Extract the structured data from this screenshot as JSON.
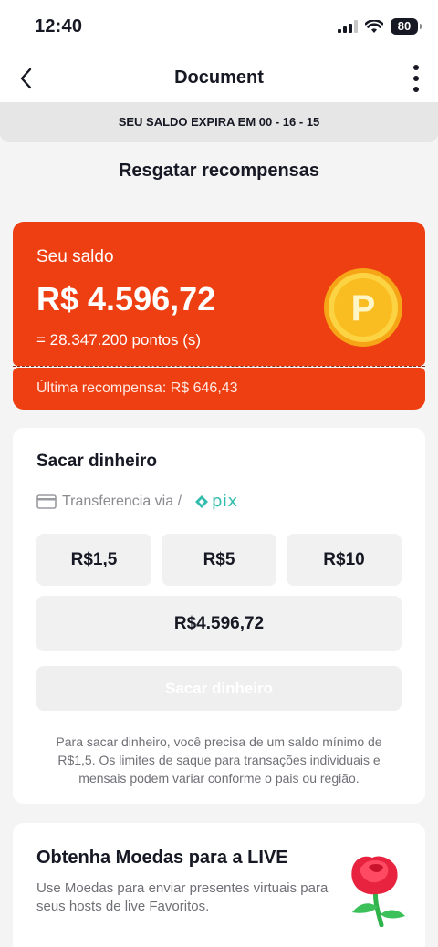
{
  "status_bar": {
    "time": "12:40",
    "battery": "80"
  },
  "nav": {
    "title": "Document"
  },
  "expiry": {
    "prefix": "SEU SALDO EXPIRA EM",
    "countdown": "00 - 16 - 15"
  },
  "page": {
    "title": "Resgatar recompensas"
  },
  "balance": {
    "label": "Seu saldo",
    "amount": "R$ 4.596,72",
    "points": "= 28.347.200 pontos (s)",
    "last_reward": "Última recompensa: R$ 646,43",
    "coin_letter": "P"
  },
  "withdraw": {
    "title": "Sacar dinheiro",
    "method": "Transferencia via /",
    "pix_label": "pix",
    "amounts": [
      "R$1,5",
      "R$5",
      "R$10"
    ],
    "full_amount": "R$4.596,72",
    "submit_label": "Sacar dinheiro",
    "note": "Para sacar dinheiro, você precisa de um saldo mínimo de R$1,5. Os limites de saque para transações individuais e mensais podem variar conforme o pais ou região."
  },
  "coins": {
    "title": "Obtenha Moedas para a LIVE",
    "description": "Use Moedas para enviar presentes virtuais para seus hosts de live Favoritos."
  },
  "colors": {
    "accent": "#ee3f12",
    "pix": "#32bcad",
    "coin": "#f7b31a"
  }
}
